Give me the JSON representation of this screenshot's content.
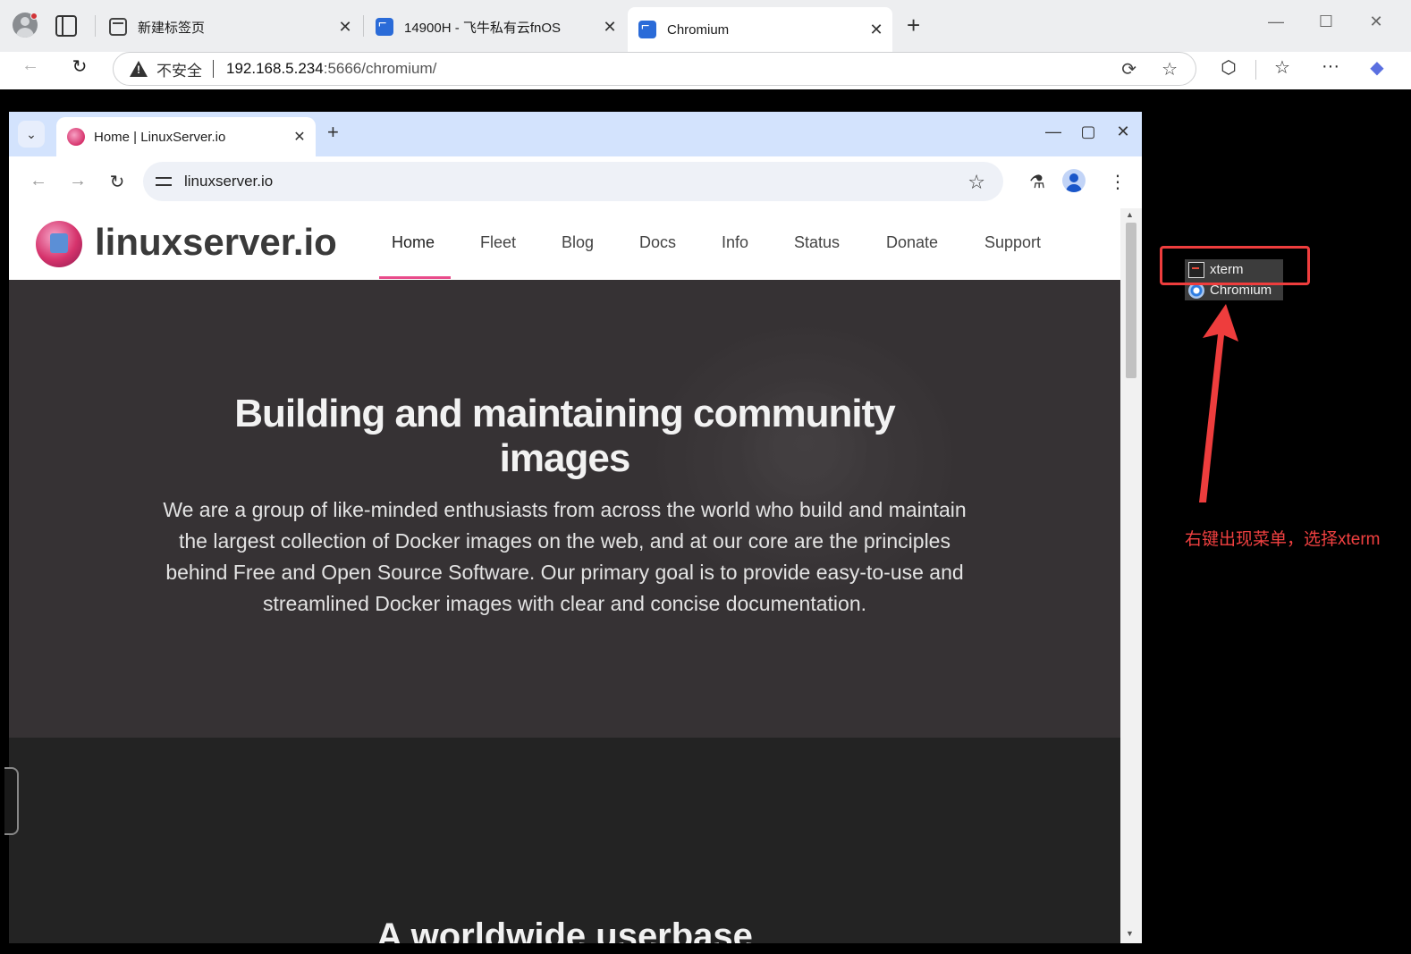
{
  "edge": {
    "tabs": [
      {
        "title": "新建标签页",
        "icon": "newtab-icon"
      },
      {
        "title": "14900H - 飞牛私有云fnOS",
        "icon": "fnos-icon"
      },
      {
        "title": "Chromium",
        "icon": "fnos-icon"
      }
    ],
    "new_tab_label": "+",
    "close_glyph": "✕",
    "window_controls": {
      "minimize": "—",
      "maximize": "☐",
      "close": "✕"
    },
    "address": {
      "security_label": "不安全",
      "host": "192.168.5.234",
      "path": ":5666/chromium/"
    }
  },
  "chromium": {
    "tab": {
      "title": "Home | LinuxServer.io"
    },
    "tab_search_glyph": "⌄",
    "new_tab_label": "+",
    "close_glyph": "✕",
    "window_controls": {
      "minimize": "—",
      "maximize": "▢",
      "close": "✕"
    },
    "omnibox_value": "linuxserver.io"
  },
  "site": {
    "wordmark": "linuxserver.io",
    "nav": [
      "Home",
      "Fleet",
      "Blog",
      "Docs",
      "Info",
      "Status",
      "Donate",
      "Support"
    ],
    "active_nav": "Home",
    "hero_title": "Building and maintaining community images",
    "hero_description": "We are a group of like-minded enthusiasts from across the world who build and maintain the largest collection of Docker images on the web, and at our core are the principles behind Free and Open Source Software. Our primary goal is to provide easy-to-use and streamlined Docker images with clear and concise documentation.",
    "next_heading": "A worldwide userbase"
  },
  "context_menu": {
    "items": [
      {
        "label": "xterm",
        "icon": "xterm-icon"
      },
      {
        "label": "Chromium",
        "icon": "chromium-icon"
      }
    ]
  },
  "annotation": {
    "text": "右键出现菜单，选择xterm",
    "color": "#ee3d3d"
  }
}
